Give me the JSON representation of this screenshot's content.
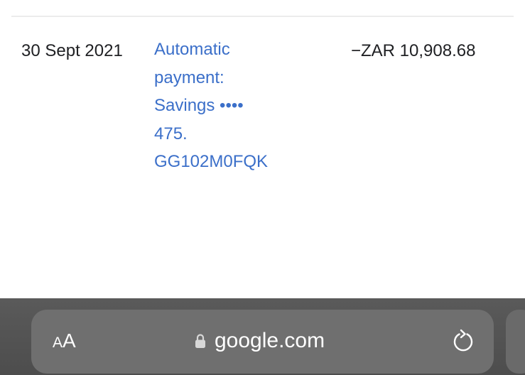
{
  "transaction": {
    "date": "30 Sept 2021",
    "description_lines": [
      "Automatic",
      "payment:",
      "Savings ••••",
      "475.",
      "GG102M0FQK"
    ],
    "amount": "−ZAR 10,908.68"
  },
  "browser_toolbar": {
    "text_size_label_large": "A",
    "text_size_label_small": "A",
    "url": "google.com"
  },
  "icons": {
    "lock": "lock-icon",
    "reload": "reload-icon"
  },
  "colors": {
    "link": "#3b6fc9",
    "toolbar": "#575757",
    "address_bar": "#6f6f6f"
  }
}
